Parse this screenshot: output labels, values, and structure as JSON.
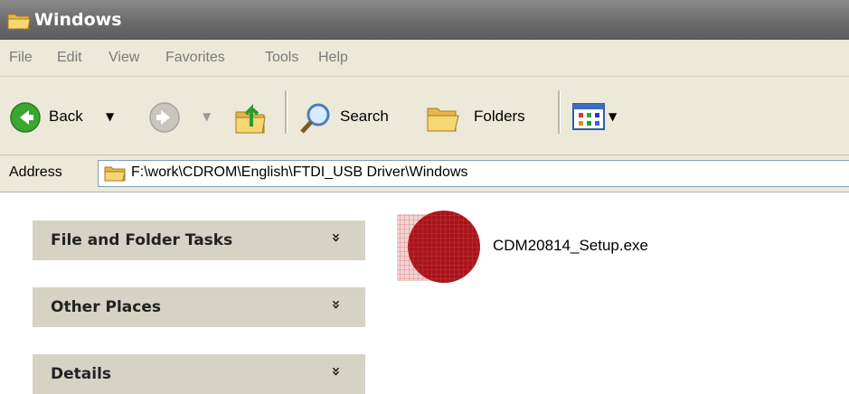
{
  "window": {
    "title": "Windows"
  },
  "menu": {
    "items": [
      "File",
      "Edit",
      "View",
      "Favorites",
      "Tools",
      "Help"
    ]
  },
  "toolbar": {
    "back_label": "Back",
    "search_label": "Search",
    "folders_label": "Folders"
  },
  "address": {
    "label": "Address",
    "path": "F:\\work\\CDROM\\English\\FTDI_USB Driver\\Windows"
  },
  "tasks": {
    "panels": [
      "File and Folder Tasks",
      "Other Places",
      "Details"
    ],
    "chevron": "»"
  },
  "files": [
    {
      "name": "CDM20814_Setup.exe",
      "icon": "installer-icon"
    }
  ],
  "colors": {
    "titlebar": "#6b6b6b",
    "chrome": "#ece9d8",
    "panel": "#d6d2c4",
    "installer": "#a8141a"
  }
}
